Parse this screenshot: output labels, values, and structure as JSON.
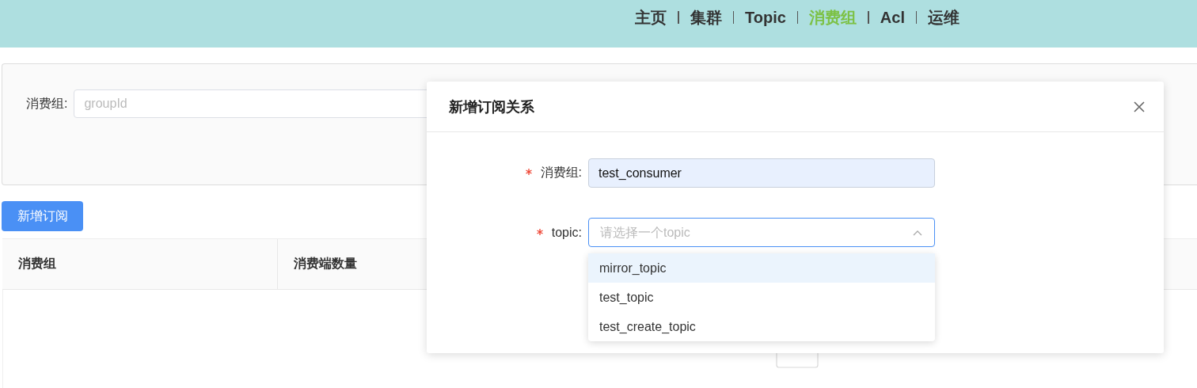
{
  "nav": {
    "items": [
      {
        "label": "主页",
        "selected": false
      },
      {
        "label": "集群",
        "selected": false
      },
      {
        "label": "Topic",
        "selected": false
      },
      {
        "label": "消费组",
        "selected": true
      },
      {
        "label": "Acl",
        "selected": false
      },
      {
        "label": "运维",
        "selected": false
      }
    ]
  },
  "search": {
    "label": "消费组:",
    "placeholder": "groupId"
  },
  "add_button": "新增订阅",
  "table": {
    "columns": [
      "消费组",
      "消费端数量"
    ]
  },
  "dialog": {
    "title": "新增订阅关系",
    "fields": [
      {
        "kind": "input",
        "label": "消费组:",
        "required": true,
        "value": "test_consumer"
      },
      {
        "kind": "select",
        "label": "topic:",
        "required": true,
        "placeholder": "请选择一个topic",
        "expanded": true,
        "options": [
          {
            "label": "mirror_topic",
            "selected": true
          },
          {
            "label": "test_topic",
            "selected": false
          },
          {
            "label": "test_create_topic",
            "selected": false
          }
        ]
      }
    ]
  }
}
